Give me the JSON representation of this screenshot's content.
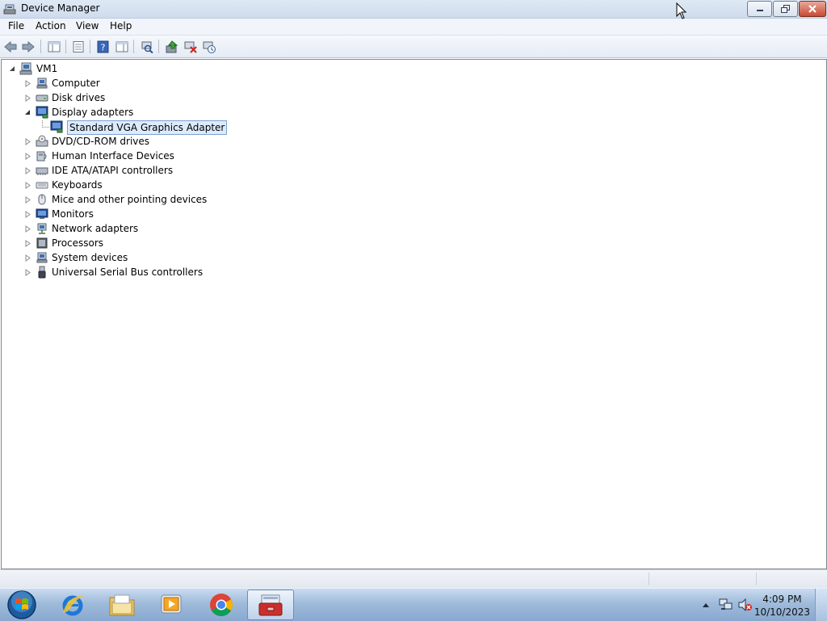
{
  "window": {
    "title": "Device Manager"
  },
  "menu": [
    "File",
    "Action",
    "View",
    "Help"
  ],
  "toolbar": {
    "icons": [
      "back-icon",
      "forward-icon",
      "show-hide-console-tree-icon",
      "properties-icon",
      "help-icon",
      "action-pane-icon",
      "scan-hardware-icon",
      "update-driver-icon",
      "disable-device-icon",
      "uninstall-device-icon"
    ]
  },
  "tree": {
    "root": "VM1",
    "categories": [
      {
        "label": "Computer",
        "icon": "computer-icon",
        "expanded": false
      },
      {
        "label": "Disk drives",
        "icon": "disk-drive-icon",
        "expanded": false
      },
      {
        "label": "Display adapters",
        "icon": "display-adapter-icon",
        "expanded": true,
        "children": [
          "Standard VGA Graphics Adapter"
        ]
      },
      {
        "label": "DVD/CD-ROM drives",
        "icon": "dvd-drive-icon",
        "expanded": false
      },
      {
        "label": "Human Interface Devices",
        "icon": "hid-icon",
        "expanded": false
      },
      {
        "label": "IDE ATA/ATAPI controllers",
        "icon": "ide-controller-icon",
        "expanded": false
      },
      {
        "label": "Keyboards",
        "icon": "keyboard-icon",
        "expanded": false
      },
      {
        "label": "Mice and other pointing devices",
        "icon": "mouse-icon",
        "expanded": false
      },
      {
        "label": "Monitors",
        "icon": "monitor-icon",
        "expanded": false
      },
      {
        "label": "Network adapters",
        "icon": "network-adapter-icon",
        "expanded": false
      },
      {
        "label": "Processors",
        "icon": "processor-icon",
        "expanded": false
      },
      {
        "label": "System devices",
        "icon": "system-devices-icon",
        "expanded": false
      },
      {
        "label": "Universal Serial Bus controllers",
        "icon": "usb-icon",
        "expanded": false
      }
    ],
    "selected": "Standard VGA Graphics Adapter"
  },
  "taskbar": {
    "buttons": [
      "start-orb-icon",
      "internet-explorer-icon",
      "windows-explorer-icon",
      "media-player-icon",
      "chrome-icon",
      "device-manager-toolbox-icon"
    ],
    "active": "device-manager-toolbox-icon",
    "tray": {
      "time": "4:09 PM",
      "date": "10/10/2023"
    }
  },
  "colors": {
    "selection": "#dcebfc",
    "selection_border": "#7da2ce",
    "titlebar": "#d5e2f1",
    "taskbar": "#9fbbdb"
  }
}
